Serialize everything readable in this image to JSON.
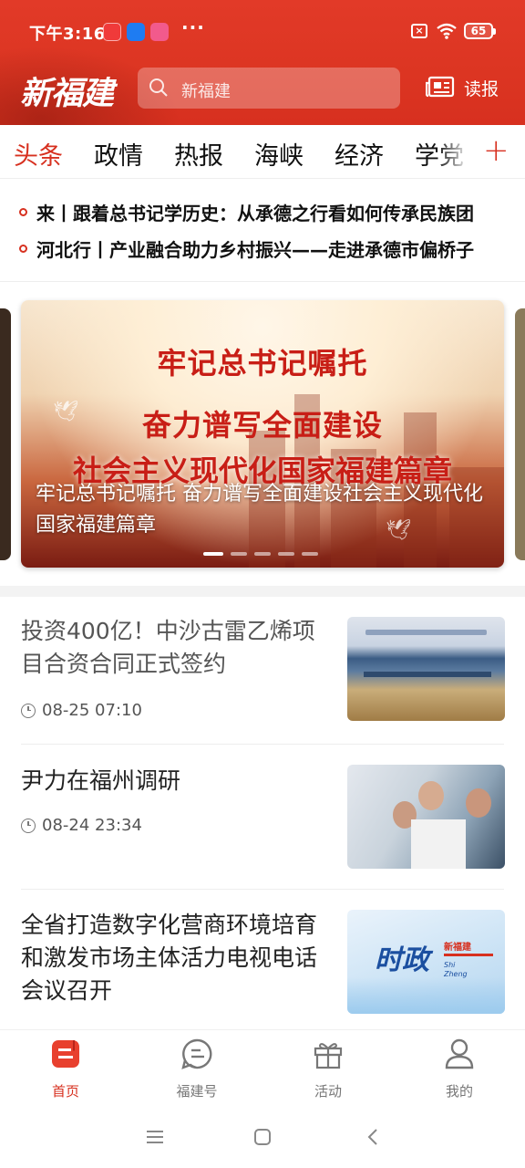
{
  "status_bar": {
    "time": "下午3:16",
    "apps": [
      "小红书",
      "知乎",
      "bilibili"
    ],
    "more": "···",
    "battery": "65"
  },
  "app_bar": {
    "logo": "新福建",
    "search_placeholder": "新福建",
    "newspaper_label": "读报"
  },
  "tabs": {
    "items": [
      "头条",
      "政情",
      "热报",
      "海峡",
      "经济",
      "学党"
    ],
    "active_index": 0,
    "add_label": "+"
  },
  "ticker": [
    "来丨跟着总书记学历史：从承德之行看如何传承民族团",
    "河北行丨产业融合助力乡村振兴——走进承德市偏桥子"
  ],
  "carousel": {
    "line1": "牢记总书记嘱托",
    "line2": "奋力谱写全面建设",
    "line3": "社会主义现代化国家福建篇章",
    "caption": "牢记总书记嘱托 奋力谱写全面建设社会主义现代化国家福建篇章",
    "slide_count": 5,
    "active_slide": 0
  },
  "news": [
    {
      "title": "投资400亿！中沙古雷乙烯项目合资合同正式签约",
      "date": "08-25",
      "time": "07:10",
      "thumbnail": "signing-ceremony-photo"
    },
    {
      "title": "尹力在福州调研",
      "date": "08-24",
      "time": "23:34",
      "thumbnail": "inspection-photo"
    },
    {
      "title": "全省打造数字化营商环境培育和激发市场主体活力电视电话会议召开",
      "thumbnail": "shizheng-banner",
      "thumb_text": "时政",
      "thumb_sub": "Shi Zheng",
      "thumb_logo": "新福建"
    }
  ],
  "bottom_nav": {
    "items": [
      {
        "label": "首页",
        "icon": "home-icon"
      },
      {
        "label": "福建号",
        "icon": "fujian-account-icon"
      },
      {
        "label": "活动",
        "icon": "gift-icon"
      },
      {
        "label": "我的",
        "icon": "profile-icon"
      }
    ],
    "active_index": 0
  },
  "colors": {
    "brand_red": "#d7301f",
    "header_red": "#e23a28"
  }
}
